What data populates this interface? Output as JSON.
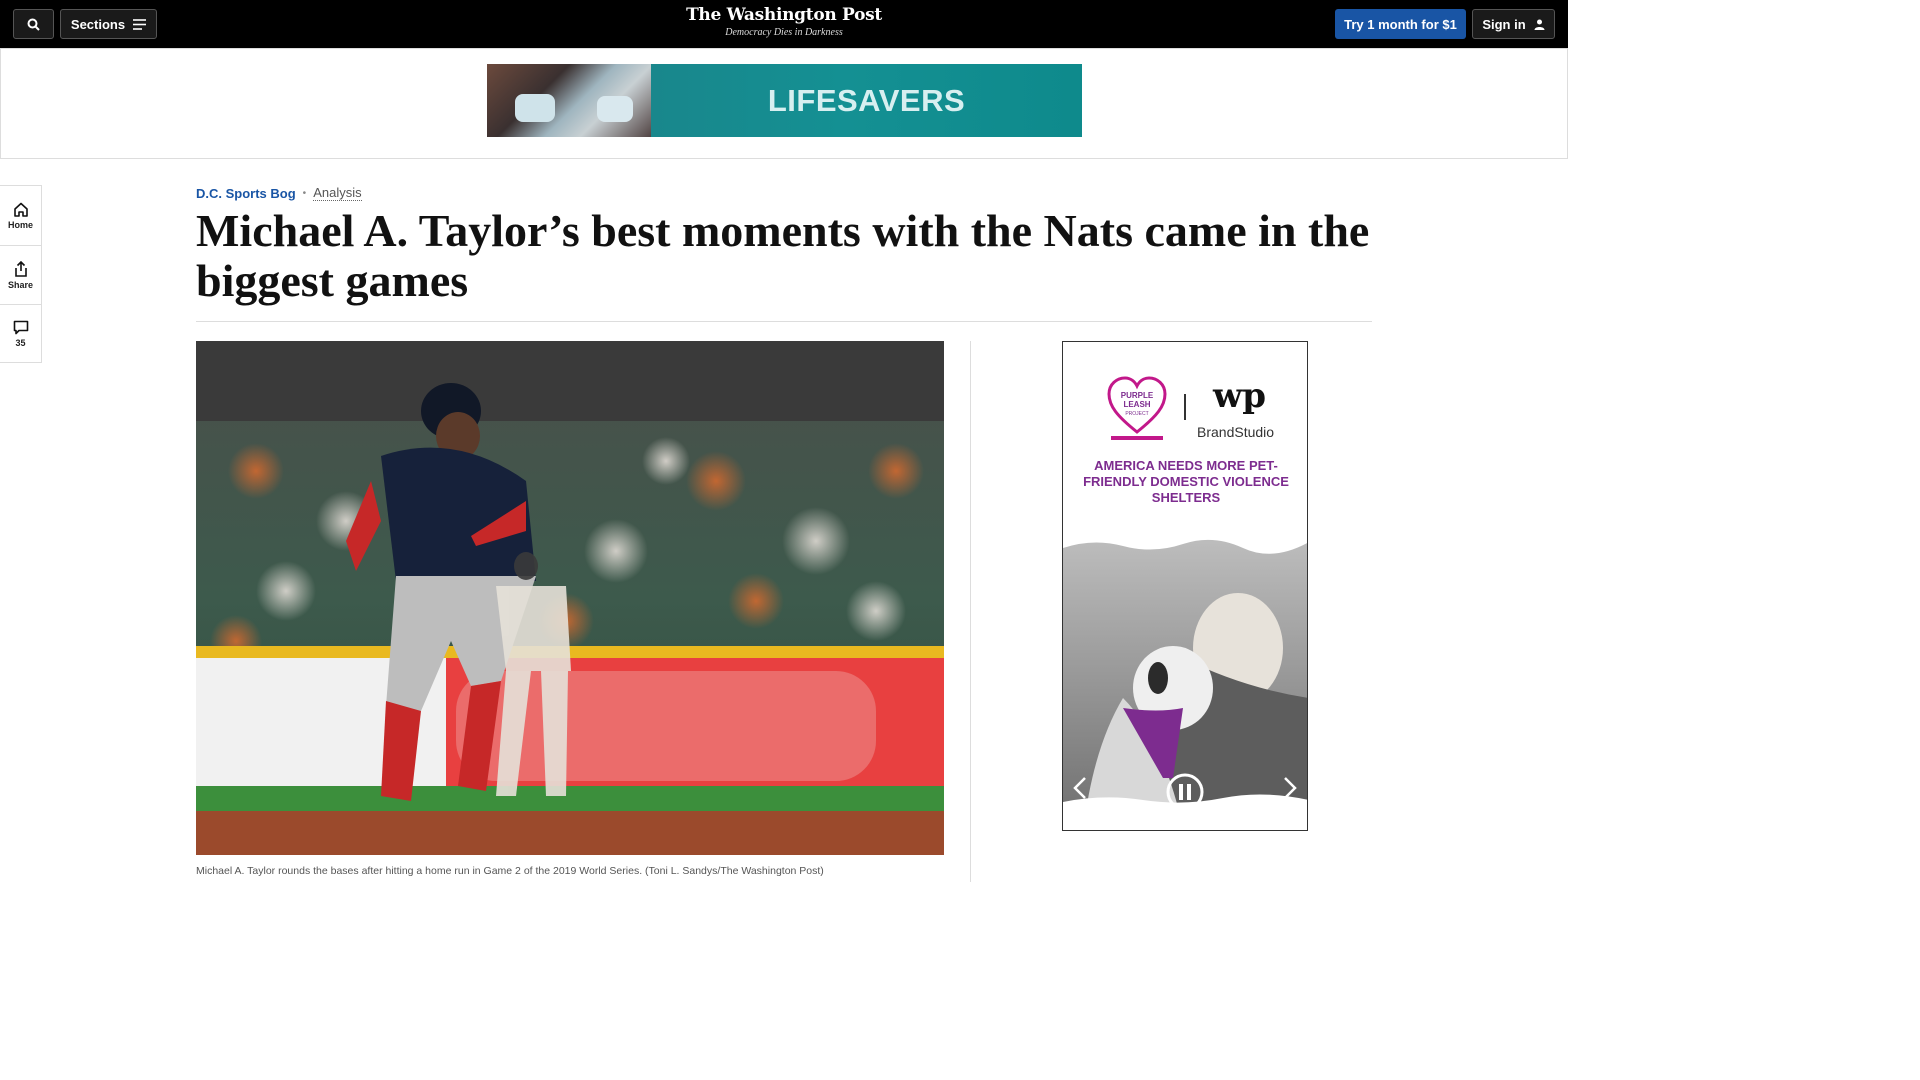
{
  "header": {
    "sections_label": "Sections",
    "logo_name": "The Washington Post",
    "logo_tagline": "Democracy Dies in Darkness",
    "try_label": "Try 1 month for $1",
    "signin_label": "Sign in"
  },
  "banner_ad": {
    "text": "LIFESAVERS"
  },
  "rail": {
    "home_label": "Home",
    "share_label": "Share",
    "comments_count": "35"
  },
  "article": {
    "section": "D.C. Sports Bog",
    "label": "Analysis",
    "headline": "Michael A. Taylor’s best moments with the Nats came in the biggest games",
    "caption": "Michael A. Taylor rounds the bases after hitting a home run in Game 2 of the 2019 World Series. (Toni L. Sandys/The Washington Post)"
  },
  "side_ad": {
    "brand_line1": "PURPLE",
    "brand_line2": "LEASH",
    "brand_line3": "PROJECT",
    "partner_logo": "wp",
    "partner": "BrandStudio",
    "message": "AMERICA NEEDS MORE PET-FRIENDLY DOMESTIC VIOLENCE SHELTERS"
  },
  "colors": {
    "accent": "#1955a5",
    "ad_purple": "#7d2c8f",
    "banner_teal": "#149093"
  }
}
